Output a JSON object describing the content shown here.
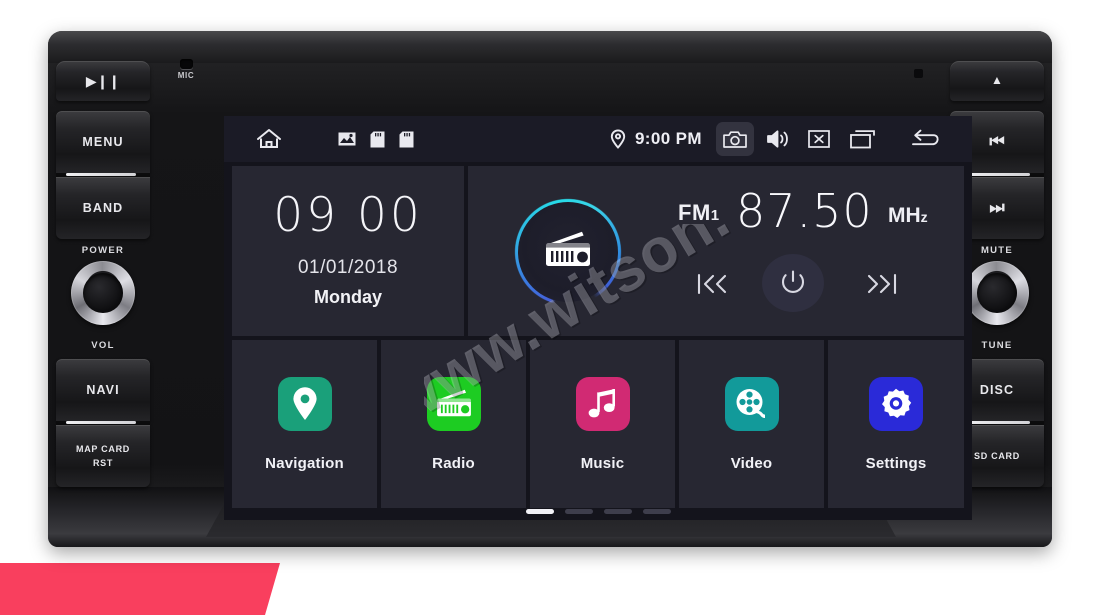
{
  "colors": {
    "accent_cyan": "#26dbe8",
    "accent_blue": "#4560d8",
    "banner_red": "#f93f5e",
    "screen_bg": "#14141c",
    "tile_bg": "#272732",
    "statusbar_bg": "#1b1b26"
  },
  "watermark": {
    "text": "www.witson.com"
  },
  "hardware": {
    "mic_label": "MIC",
    "left_keys": [
      {
        "name": "play-pause",
        "label": "▶❙❙",
        "kind": "glyph"
      },
      {
        "name": "menu",
        "label": "MENU",
        "kind": "text"
      },
      {
        "name": "band",
        "label": "BAND",
        "kind": "text"
      },
      {
        "name": "navi",
        "label": "NAVI",
        "kind": "text"
      },
      {
        "name": "map-card-rst",
        "label": "MAP CARD\nRST",
        "kind": "text"
      }
    ],
    "left_knob": {
      "top_label": "POWER",
      "bottom_label": "VOL"
    },
    "right_keys": [
      {
        "name": "eject",
        "label": "⏏",
        "kind": "glyph"
      },
      {
        "name": "prev-track",
        "label": "⏮",
        "kind": "glyph"
      },
      {
        "name": "next-track",
        "label": "⏭",
        "kind": "glyph"
      },
      {
        "name": "disc",
        "label": "DISC",
        "kind": "text"
      },
      {
        "name": "sd-card",
        "label": "SD CARD",
        "kind": "text"
      }
    ],
    "right_knob": {
      "top_label": "MUTE",
      "bottom_label": "TUNE"
    },
    "left_labels": {
      "play_pause": "▶❙❙",
      "menu": "MENU",
      "band": "BAND",
      "navi": "NAVI",
      "map_card": "MAP CARD",
      "rst": "RST",
      "power": "POWER",
      "vol": "VOL"
    },
    "right_labels": {
      "eject": "▲",
      "prev": "⏮",
      "next": "⏭",
      "mute": "MUTE",
      "tune": "TUNE",
      "disc": "DISC",
      "sd_card": "SD CARD"
    }
  },
  "statusbar": {
    "time": "9:00 PM",
    "icons": [
      "home-icon",
      "gallery-icon",
      "sd-card-icon",
      "sd-card-icon",
      "location-pin-icon",
      "camera-icon",
      "volume-icon",
      "close-box-icon",
      "recent-apps-icon",
      "back-icon"
    ],
    "camera_selected": true
  },
  "clock_widget": {
    "hours": "09",
    "minutes": "00",
    "time_display": "09 00",
    "date": "01/01/2018",
    "weekday": "Monday"
  },
  "radio_widget": {
    "band": "FM1",
    "band_main": "FM",
    "band_sub": "1",
    "frequency": "87.50",
    "unit_main": "MH",
    "unit_sub": "z",
    "unit": "MHz",
    "ring_progress_pct": 78,
    "controls": {
      "prev_label": "❙≪",
      "power_label": "⏻",
      "next_label": "≫❙"
    }
  },
  "apps": [
    {
      "label": "Navigation",
      "icon": "location-pin-icon",
      "color": "#1aa07a"
    },
    {
      "label": "Radio",
      "icon": "radio-icon",
      "color": "#1dcc22"
    },
    {
      "label": "Music",
      "icon": "music-note-icon",
      "color": "#d12a73"
    },
    {
      "label": "Video",
      "icon": "film-reel-icon",
      "color": "#129a9a"
    },
    {
      "label": "Settings",
      "icon": "gear-icon",
      "color": "#2a2ad8"
    }
  ],
  "pager": {
    "count": 4,
    "active_index": 0
  }
}
